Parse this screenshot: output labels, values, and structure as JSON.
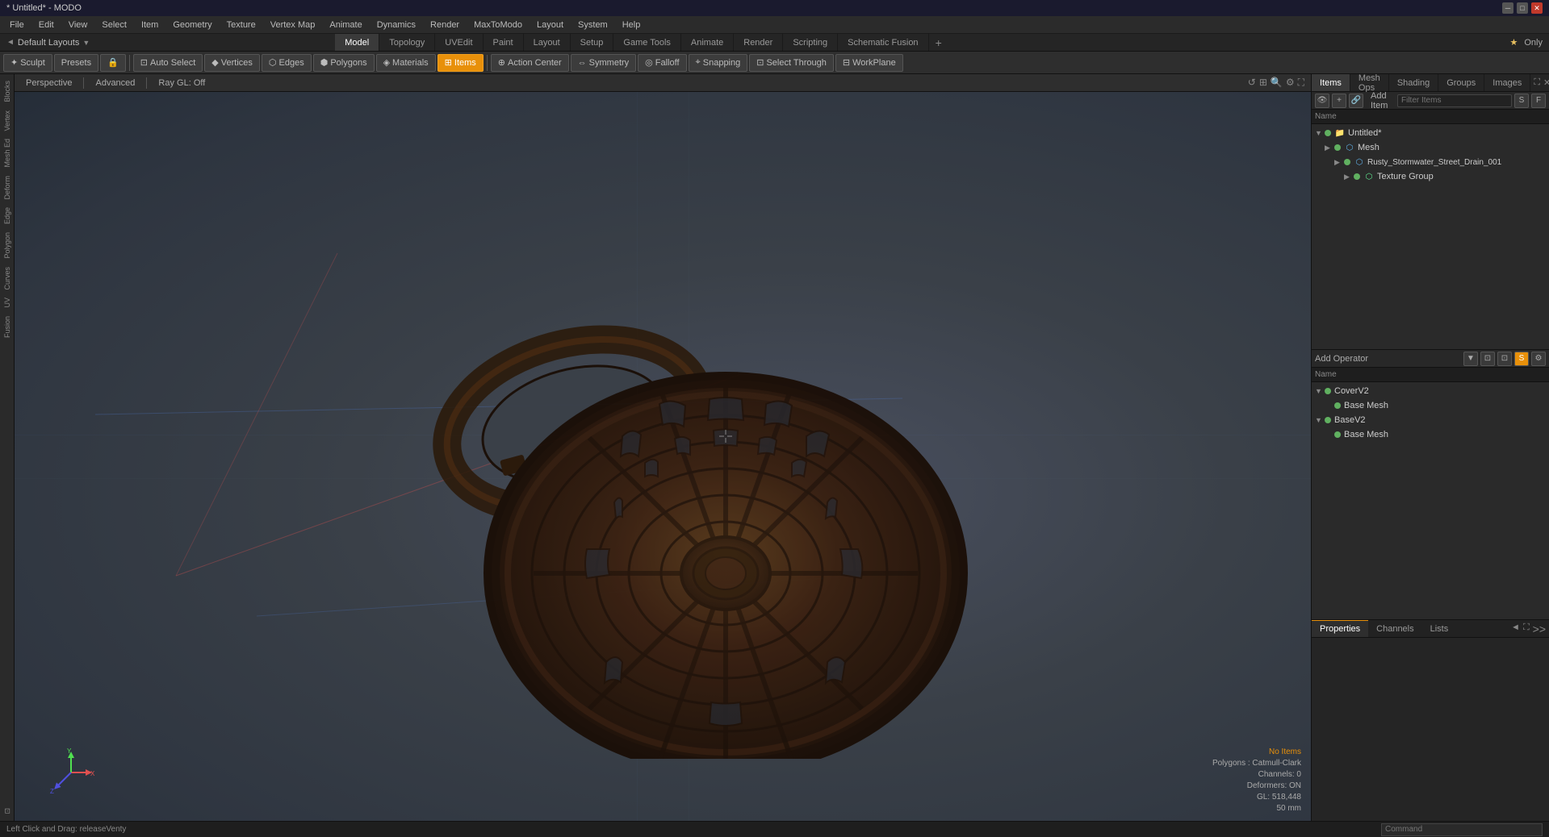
{
  "window": {
    "title": "* Untitled* - MODO"
  },
  "menubar": {
    "items": [
      "File",
      "Edit",
      "View",
      "Select",
      "Item",
      "Geometry",
      "Texture",
      "Vertex Map",
      "Animate",
      "Dynamics",
      "Render",
      "MaxToModo",
      "Layout",
      "System",
      "Help"
    ]
  },
  "layoutsbar": {
    "name": "Default Layouts",
    "dropdown_arrow": "▼"
  },
  "tabs": {
    "items": [
      {
        "label": "Model",
        "active": true
      },
      {
        "label": "Topology",
        "active": false
      },
      {
        "label": "UVEdit",
        "active": false
      },
      {
        "label": "Paint",
        "active": false
      },
      {
        "label": "Layout",
        "active": false
      },
      {
        "label": "Setup",
        "active": false
      },
      {
        "label": "Game Tools",
        "active": false
      },
      {
        "label": "Animate",
        "active": false
      },
      {
        "label": "Render",
        "active": false
      },
      {
        "label": "Scripting",
        "active": false
      },
      {
        "label": "Schematic Fusion",
        "active": false
      }
    ],
    "add": "+"
  },
  "toolbar": {
    "sculpt_label": "Sculpt",
    "presets_label": "Presets",
    "auto_select_label": "Auto Select",
    "vertices_label": "Vertices",
    "edges_label": "Edges",
    "polygons_label": "Polygons",
    "materials_label": "Materials",
    "items_label": "Items",
    "action_center_label": "Action Center",
    "symmetry_label": "Symmetry",
    "falloff_label": "Falloff",
    "snapping_label": "Snapping",
    "select_through_label": "Select Through",
    "workplane_label": "WorkPlane"
  },
  "viewport": {
    "mode": "Perspective",
    "advanced": "Advanced",
    "ray_gl": "Ray GL: Off",
    "status": {
      "no_items": "No Items",
      "polygons": "Polygons : Catmull-Clark",
      "channels": "Channels: 0",
      "deformers": "Deformers: ON",
      "gl": "GL: 518,448",
      "size": "50 mm"
    }
  },
  "right_panel": {
    "tabs": [
      "Items",
      "Mesh Ops",
      "Shading",
      "Groups",
      "Images"
    ],
    "add_item_label": "Add Item",
    "filter_placeholder": "Filter Items",
    "column_header": "Name",
    "tree": [
      {
        "id": "untitled",
        "label": "Untitled*",
        "indent": 0,
        "type": "folder",
        "expanded": true,
        "visible": true,
        "modified": true
      },
      {
        "id": "mesh",
        "label": "Mesh",
        "indent": 1,
        "type": "mesh",
        "expanded": false,
        "visible": true
      },
      {
        "id": "rusty",
        "label": "Rusty_Stormwater_Street_Drain_001",
        "indent": 2,
        "type": "mesh",
        "expanded": true,
        "visible": true
      },
      {
        "id": "texture_group",
        "label": "Texture Group",
        "indent": 3,
        "type": "texture",
        "expanded": false,
        "visible": true
      }
    ]
  },
  "operators_panel": {
    "title": "Add Operator",
    "dropdown": "▼",
    "column_header": "Name",
    "items": [
      {
        "id": "coverv2",
        "label": "CoverV2",
        "indent": 0,
        "visible": true,
        "expanded": true
      },
      {
        "id": "base_mesh_1",
        "label": "Base Mesh",
        "indent": 1,
        "visible": true
      },
      {
        "id": "basev2",
        "label": "BaseV2",
        "indent": 0,
        "visible": true,
        "expanded": true
      },
      {
        "id": "base_mesh_2",
        "label": "Base Mesh",
        "indent": 1,
        "visible": true
      }
    ]
  },
  "bottom_right": {
    "tabs": [
      "Properties",
      "Channels",
      "Lists"
    ],
    "command_placeholder": "Command"
  },
  "statusbar": {
    "text": "Left Click and Drag:  releaseVenty"
  },
  "left_sidebar": {
    "tabs": [
      "Blocks",
      "Vertex",
      "Mesh Ed",
      "Deform",
      "Edge",
      "Polygon",
      "Curves",
      "UV",
      "Fusion"
    ]
  }
}
